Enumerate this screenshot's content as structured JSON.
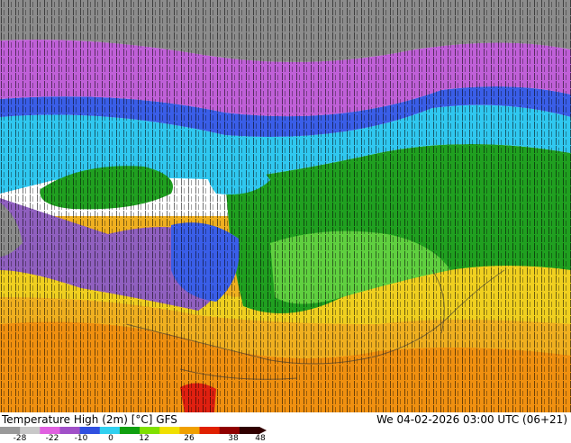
{
  "footer": {
    "title": "Temperature High (2m) [°C] GFS",
    "datetime": "We 04-02-2026 03:00 UTC (06+21)"
  },
  "legend": {
    "ticks": [
      "-28",
      "-22",
      "-10",
      "0",
      "12",
      "26",
      "38",
      "48"
    ],
    "colors": [
      "#9a9a9a",
      "#c8c8c8",
      "#e060e0",
      "#a050c8",
      "#3050e0",
      "#30d0f0",
      "#10a010",
      "#80e000",
      "#f0e000",
      "#f0a000",
      "#e02000",
      "#900000",
      "#300000"
    ]
  },
  "map": {
    "colors": {
      "gray": "#8c8c8c",
      "magenta": "#c060d8",
      "purple": "#9060c0",
      "blue": "#3a5ee8",
      "cyan": "#30c8f0",
      "green": "#20a020",
      "lightgreen": "#60d040",
      "yellow": "#f0d020",
      "orange": "#f0a010",
      "red": "#e02010"
    }
  }
}
